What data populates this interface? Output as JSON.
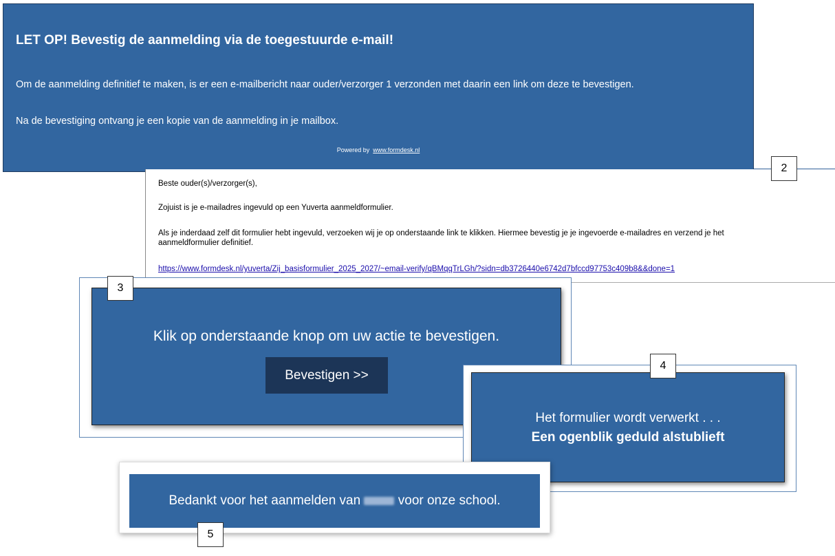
{
  "panel1": {
    "title": "LET OP! Bevestig de aanmelding via de toegestuurde e-mail!",
    "line1": "Om de aanmelding definitief te maken, is er een e-mailbericht naar ouder/verzorger 1 verzonden met daarin een link om deze te bevestigen.",
    "line2": "Na de bevestiging ontvang je een kopie van de aanmelding in je mailbox.",
    "powered_by": "Powered by",
    "powered_link": "www.formdesk.nl"
  },
  "panel2": {
    "callout": "2",
    "greeting": "Beste ouder(s)/verzorger(s),",
    "line1": "Zojuist is je e-mailadres ingevuld op een Yuverta aanmeldformulier.",
    "line2a": "Als je inderdaad zelf dit formulier hebt ingevuld, verzoeken wij je op onderstaande link te klikken. Hiermee bevestig je je ingevoerde e-mailadres en verzend je het",
    "line2b": "aanmeldformulier definitief.",
    "link": "https://www.formdesk.nl/yuverta/Zij_basisformulier_2025_2027/~email-verify/qBMqqTrLGh/?sidn=db3726440e6742d7bfccd97753c409b8&&done=1"
  },
  "panel3": {
    "callout": "3",
    "message": "Klik op onderstaande knop om uw actie te bevestigen.",
    "button": "Bevestigen >>"
  },
  "panel4": {
    "callout": "4",
    "line1": "Het formulier wordt verwerkt . . .",
    "line2": "Een ogenblik geduld alstublieft"
  },
  "panel5": {
    "callout": "5",
    "before": "Bedankt voor het aanmelden van",
    "after": "voor onze school."
  },
  "colors": {
    "panel_blue": "#3266a0",
    "button_dark": "#1c3557",
    "link": "#1a0dab"
  }
}
